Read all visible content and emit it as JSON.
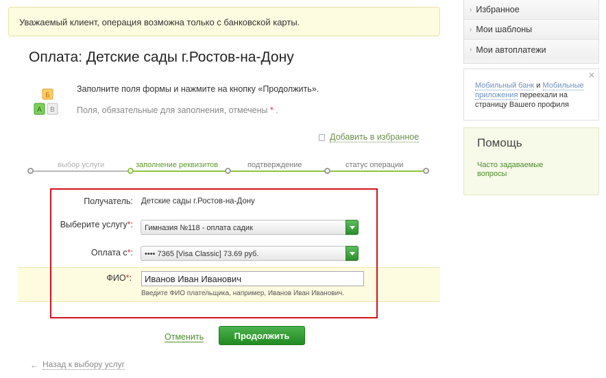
{
  "notice": "Уважаемый клиент, операция возможна только с банковской карты.",
  "page": {
    "title": "Оплата: Детские сады г.Ростов-на-Дону",
    "intro": "Заполните поля формы и нажмите на кнопку «Продолжить».",
    "required_note": "Поля, обязательные для заполнения, отмечены",
    "required_star": "*",
    "required_end": "."
  },
  "favorites": {
    "label": "Добавить в избранное"
  },
  "icon_letters": {
    "top": "Б",
    "left": "А",
    "right": "В"
  },
  "steps": [
    {
      "label": "выбор услуги",
      "state": "done"
    },
    {
      "label": "заполнение реквизитов",
      "state": "current"
    },
    {
      "label": "подтверждение",
      "state": "pending"
    },
    {
      "label": "статус операции",
      "state": "pending"
    }
  ],
  "form": {
    "recipient_label": "Получатель:",
    "recipient_value": "Детские сады г.Ростов-на-Дону",
    "service_label": "Выберите услугу",
    "service_value": "Гимназия №118 - оплата садик",
    "payment_label": "Оплата с",
    "payment_value": "•••• 7365 [Visa Classic] 73.69 руб.",
    "fio_label": "ФИО",
    "fio_value": "Иванов Иван Иванович",
    "fio_hint": "Введите ФИО плательщика, например, Иванов Иван Иванович.",
    "star": "*",
    "colon": ":"
  },
  "actions": {
    "cancel": "Отменить",
    "continue": "Продолжить",
    "back": "Назад к выбору услуг"
  },
  "sidebar": {
    "menu": [
      "Избранное",
      "Мои шаблоны",
      "Мои автоплатежи"
    ],
    "info": {
      "link1": "Мобильный банк",
      "and": " и ",
      "link2": "Мобильные приложения",
      "rest": " переехали на страницу Вашего профиля"
    },
    "help": {
      "title": "Помощь",
      "faq": "Часто задаваемые вопросы"
    }
  },
  "colors": {
    "accent_green": "#2c8e2c",
    "frame_red": "#d0111b",
    "step_green": "#8cc63f"
  }
}
